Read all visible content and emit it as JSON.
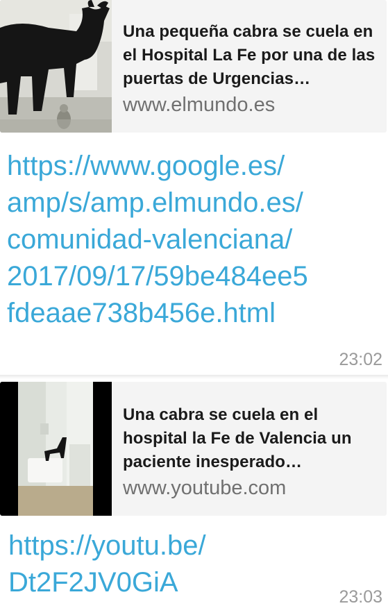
{
  "messages": [
    {
      "preview": {
        "title": "Una pequeña cabra se cuela en el Hospital La Fe por una de las puertas de Urgencias…",
        "domain": "www.elmundo.es",
        "thumbnail_icon": "goat-photo-thumbnail"
      },
      "link_lines": [
        "https://www.google.es/",
        "amp/s/amp.elmundo.es/",
        "comunidad-valenciana/",
        "2017/09/17/59be484ee5",
        "fdeaae738b456e.html"
      ],
      "time": "23:02"
    },
    {
      "preview": {
        "title": "Una cabra se cuela en el hospital la Fe de Valencia un paciente inesperado…",
        "domain": "www.youtube.com",
        "thumbnail_icon": "goat-in-hospital-video-thumbnail"
      },
      "link_lines": [
        "https://youtu.be/",
        "Dt2F2JV0GiA"
      ],
      "time": "23:03"
    }
  ],
  "colors": {
    "link": "#3aa8d8",
    "preview_bg": "#f4f4f4",
    "title": "#1a1a1a",
    "domain": "#707070",
    "time": "#9a9a9a"
  }
}
